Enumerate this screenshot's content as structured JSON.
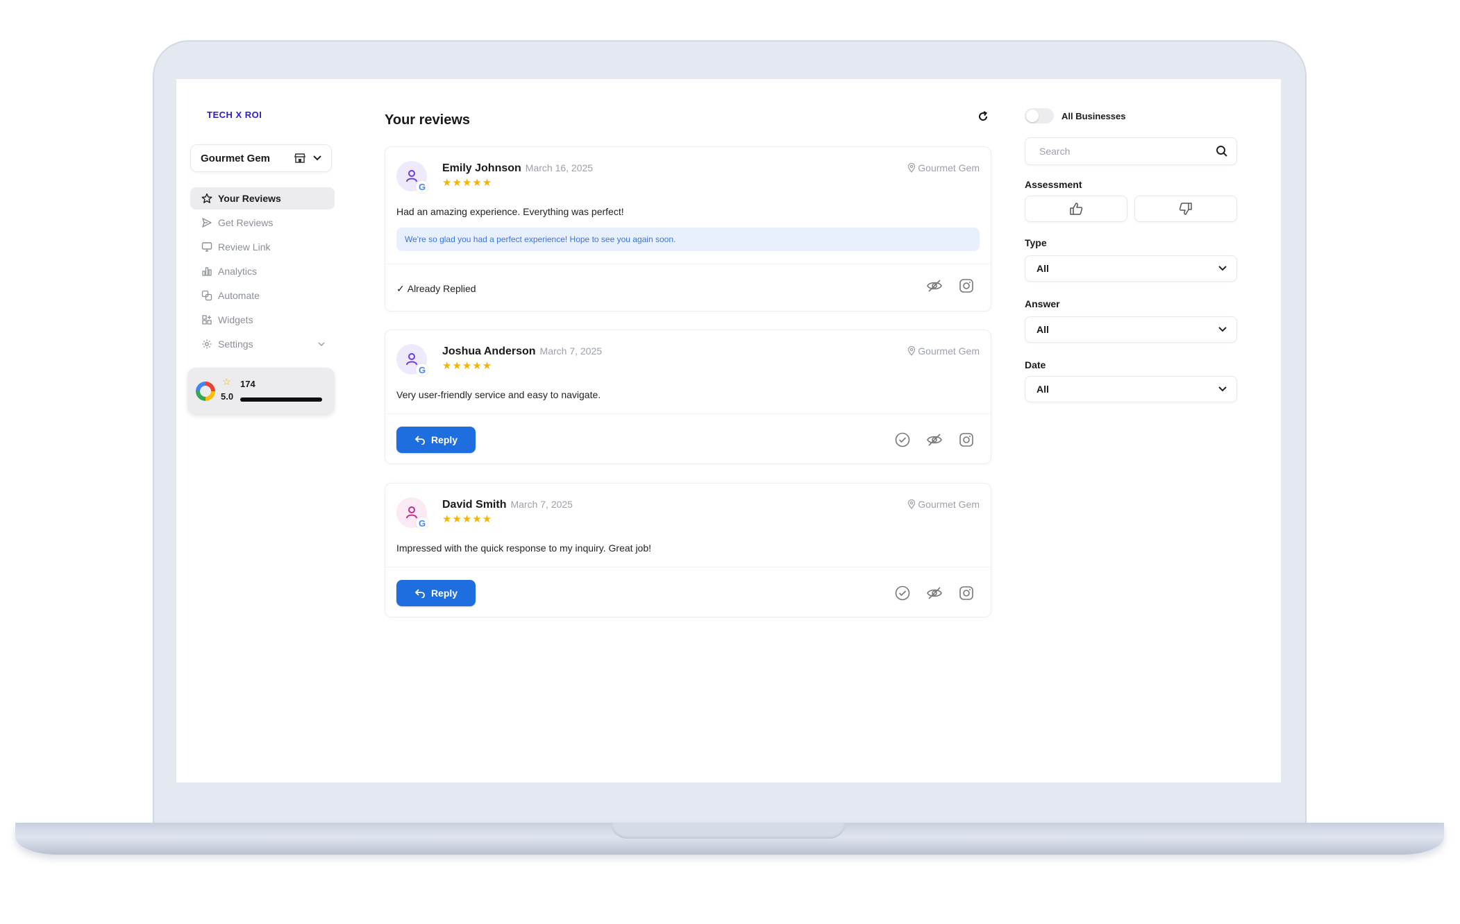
{
  "brand": {
    "logo": "TECH X ROI"
  },
  "business_select": {
    "value": "Gourmet Gem"
  },
  "sidebar": {
    "items": [
      {
        "label": "Your Reviews",
        "icon": "star-icon",
        "active": true
      },
      {
        "label": "Get Reviews",
        "icon": "send-icon"
      },
      {
        "label": "Review Link",
        "icon": "monitor-icon"
      },
      {
        "label": "Analytics",
        "icon": "bar-chart-icon"
      },
      {
        "label": "Automate",
        "icon": "automate-icon"
      },
      {
        "label": "Widgets",
        "icon": "widgets-icon"
      },
      {
        "label": "Settings",
        "icon": "gear-icon",
        "has_chevron": true
      }
    ]
  },
  "rating_card": {
    "count": "174",
    "score": "5.0",
    "bar_fraction": 1.0
  },
  "main": {
    "title": "Your reviews",
    "reviews": [
      {
        "name": "Emily Johnson",
        "date": "March 16, 2025",
        "stars": "★★★★★",
        "location": "Gourmet Gem",
        "text": "Had an amazing experience. Everything was perfect!",
        "reply": "We're so glad you had a perfect experience! Hope to see you again soon.",
        "status": "Already Replied"
      },
      {
        "name": "Joshua Anderson",
        "date": "March 7, 2025",
        "stars": "★★★★★",
        "location": "Gourmet Gem",
        "text": "Very user-friendly service and easy to navigate.",
        "action": "Reply"
      },
      {
        "name": "David Smith",
        "date": "March 7, 2025",
        "stars": "★★★★★",
        "location": "Gourmet Gem",
        "text": "Impressed with the quick response to my inquiry. Great job!",
        "action": "Reply"
      }
    ]
  },
  "filters": {
    "toggle_label": "All Businesses",
    "search_placeholder": "Search",
    "assessment_label": "Assessment",
    "type_label": "Type",
    "type_value": "All",
    "answer_label": "Answer",
    "answer_value": "All",
    "date_label": "Date",
    "date_value": "All"
  },
  "colors": {
    "accent": "#1e6ee0",
    "star": "#f5b400",
    "logo": "#2b1bd8",
    "reply_bg": "#e8f0fd"
  }
}
